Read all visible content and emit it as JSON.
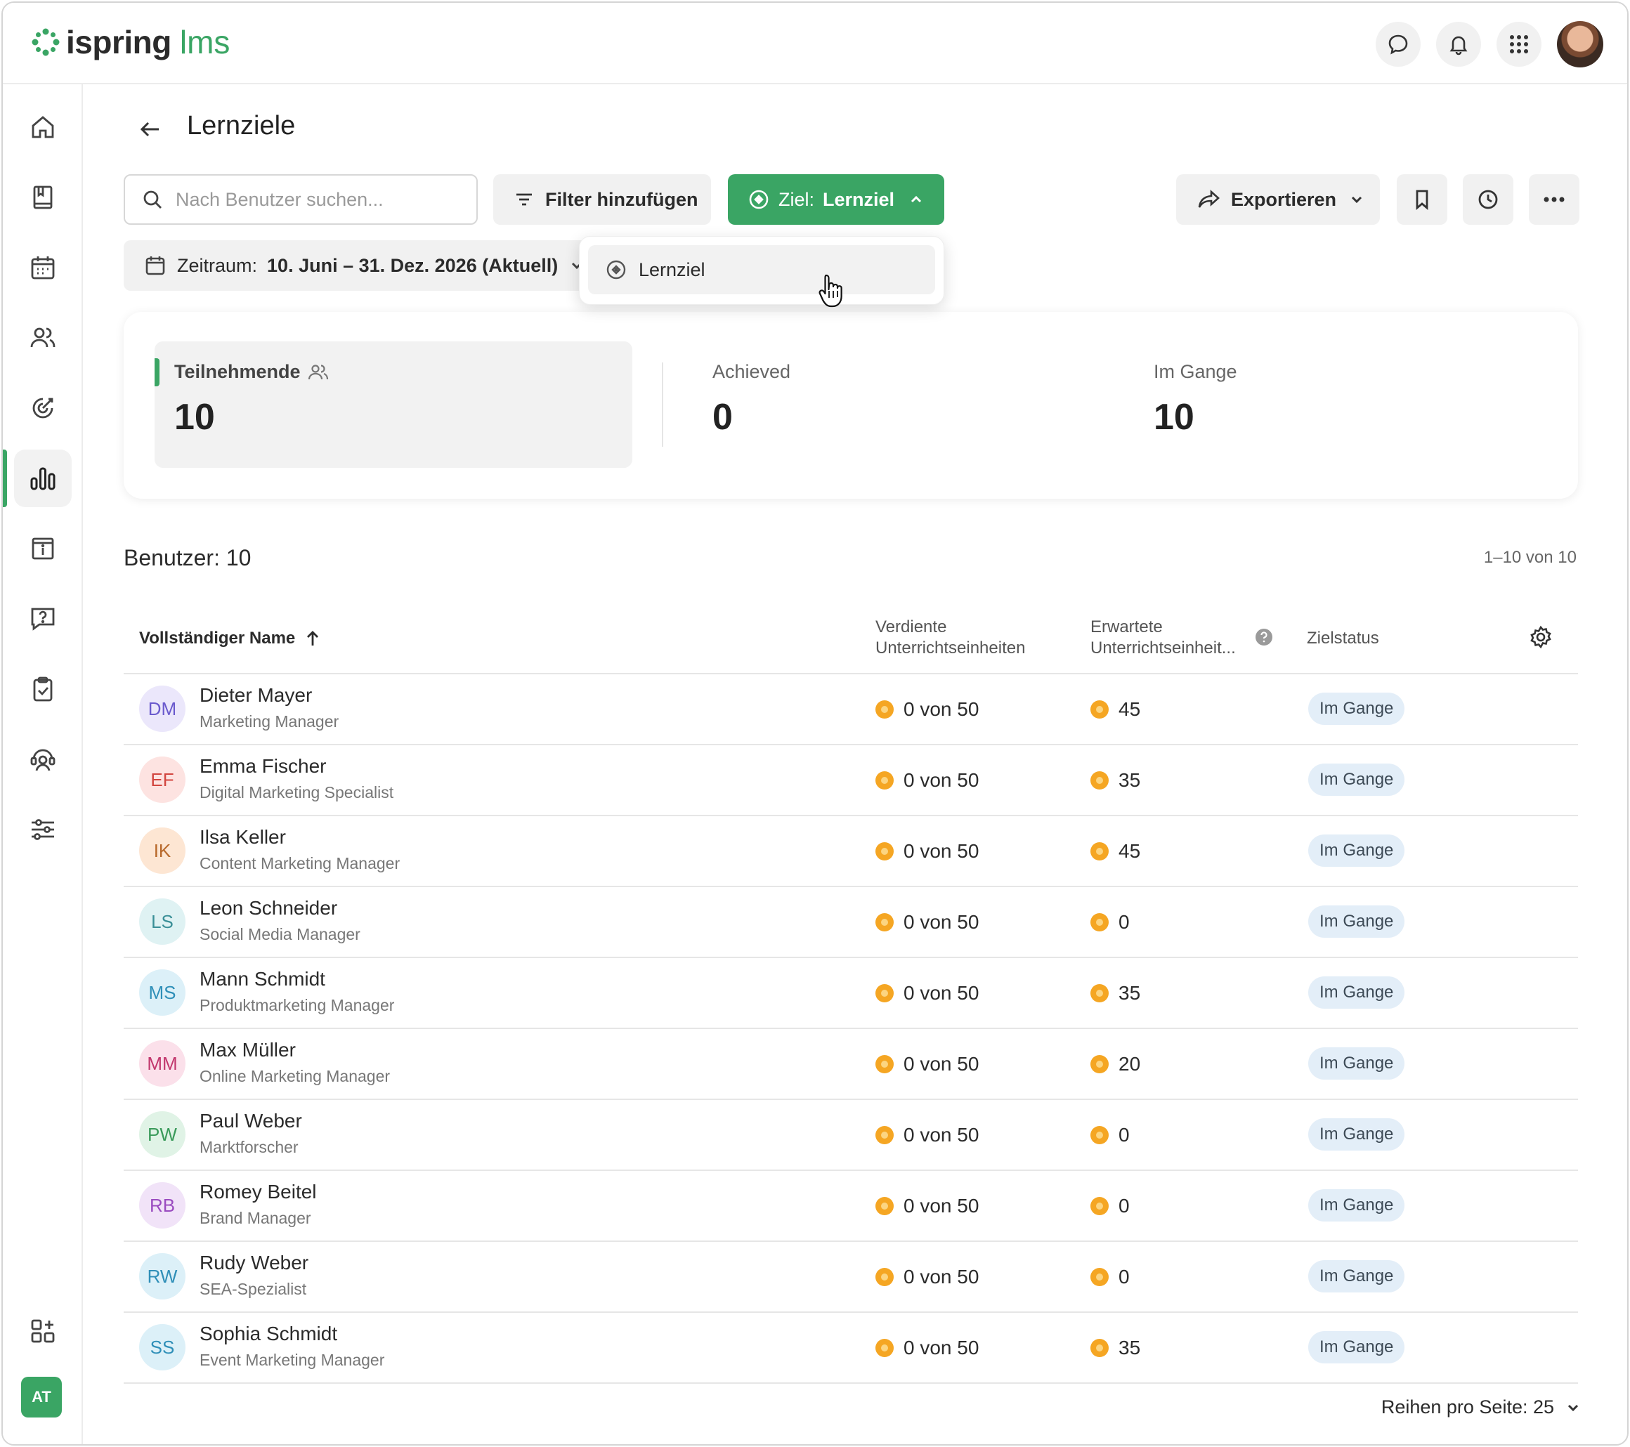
{
  "brand": {
    "name": "ispring",
    "suffix": "lms",
    "accent": "#3aa564"
  },
  "topbar": {
    "icons": [
      "chat-icon",
      "bell-icon",
      "apps-grid-icon"
    ],
    "avatar": "user-avatar-photo"
  },
  "sidebar": {
    "items": [
      {
        "icon": "home-icon"
      },
      {
        "icon": "book-icon"
      },
      {
        "icon": "calendar-icon"
      },
      {
        "icon": "users-icon"
      },
      {
        "icon": "target-icon"
      },
      {
        "icon": "reports-chart-icon",
        "active": true
      },
      {
        "icon": "info-card-icon"
      },
      {
        "icon": "question-message-icon"
      },
      {
        "icon": "clipboard-check-icon"
      },
      {
        "icon": "support-agent-icon"
      },
      {
        "icon": "sliders-icon"
      }
    ],
    "add_widget_icon": "add-widget-icon",
    "user_initials": "AT"
  },
  "page": {
    "title": "Lernziele"
  },
  "toolbar": {
    "search_placeholder": "Nach Benutzer suchen...",
    "filter_label": "Filter hinzufügen",
    "goal_prefix": "Ziel:",
    "goal_value": "Lernziel",
    "export_label": "Exportieren",
    "period_prefix": "Zeitraum:",
    "period_value": "10. Juni – 31. Dez. 2026 (Aktuell)"
  },
  "dropdown": {
    "items": [
      {
        "label": "Lernziel"
      }
    ]
  },
  "summary": {
    "participants": {
      "label": "Teilnehmende",
      "value": "10"
    },
    "achieved": {
      "label": "Achieved",
      "value": "0"
    },
    "in_progress": {
      "label": "Im Gange",
      "value": "10"
    }
  },
  "table": {
    "count_label": "Benutzer: 10",
    "range": "1–10 von 10",
    "columns": {
      "name": "Vollständiger Name",
      "earned_line1": "Verdiente",
      "earned_line2": "Unterrichtseinheiten",
      "expected_line1": "Erwartete",
      "expected_line2": "Unterrichtseinheit...",
      "status": "Zielstatus"
    },
    "rows": [
      {
        "initials": "DM",
        "name": "Dieter Mayer",
        "role": "Marketing Manager",
        "earned": "0 von 50",
        "expected": "45",
        "status": "Im Gange",
        "color": "#6a5acd",
        "bg": "#ebe7fb"
      },
      {
        "initials": "EF",
        "name": "Emma Fischer",
        "role": "Digital Marketing Specialist",
        "earned": "0 von 50",
        "expected": "35",
        "status": "Im Gange",
        "color": "#d2453f",
        "bg": "#fde3e1"
      },
      {
        "initials": "IK",
        "name": "Ilsa Keller",
        "role": "Content Marketing Manager",
        "earned": "0 von 50",
        "expected": "45",
        "status": "Im Gange",
        "color": "#b8692b",
        "bg": "#fde6d3"
      },
      {
        "initials": "LS",
        "name": "Leon Schneider",
        "role": "Social Media Manager",
        "earned": "0 von 50",
        "expected": "0",
        "status": "Im Gange",
        "color": "#3a8f97",
        "bg": "#dff2f3"
      },
      {
        "initials": "MS",
        "name": "Mann Schmidt",
        "role": "Produktmarketing Manager",
        "earned": "0 von 50",
        "expected": "35",
        "status": "Im Gange",
        "color": "#2f8fb8",
        "bg": "#dcf0f8"
      },
      {
        "initials": "MM",
        "name": "Max Müller",
        "role": "Online Marketing Manager",
        "earned": "0 von 50",
        "expected": "20",
        "status": "Im Gange",
        "color": "#c2376d",
        "bg": "#fbe0ea"
      },
      {
        "initials": "PW",
        "name": "Paul Weber",
        "role": "Marktforscher",
        "earned": "0 von 50",
        "expected": "0",
        "status": "Im Gange",
        "color": "#3a9a5a",
        "bg": "#e0f3e6"
      },
      {
        "initials": "RB",
        "name": "Romey Beitel",
        "role": "Brand Manager",
        "earned": "0 von 50",
        "expected": "0",
        "status": "Im Gange",
        "color": "#9a4bc0",
        "bg": "#f1e3f8"
      },
      {
        "initials": "RW",
        "name": "Rudy Weber",
        "role": "SEA-Spezialist",
        "earned": "0 von 50",
        "expected": "0",
        "status": "Im Gange",
        "color": "#2f8fb8",
        "bg": "#dcf0f8"
      },
      {
        "initials": "SS",
        "name": "Sophia Schmidt",
        "role": "Event Marketing Manager",
        "earned": "0 von 50",
        "expected": "35",
        "status": "Im Gange",
        "color": "#2f8fb8",
        "bg": "#dcf0f8"
      }
    ],
    "rows_per_page_label": "Reihen pro Seite: 25"
  }
}
